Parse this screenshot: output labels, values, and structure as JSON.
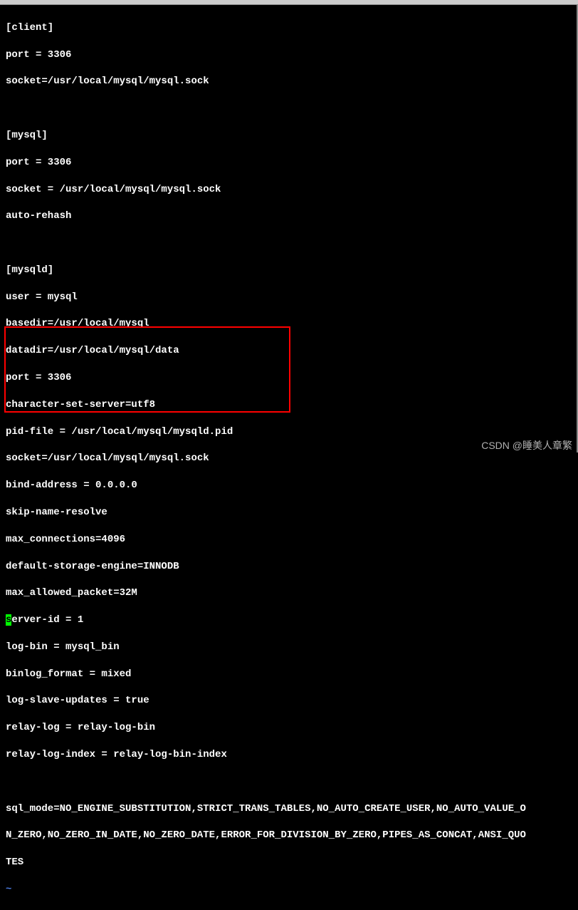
{
  "config": {
    "client": {
      "section": "[client]",
      "port": "port = 3306",
      "socket": "socket=/usr/local/mysql/mysql.sock"
    },
    "mysql": {
      "section": "[mysql]",
      "port": "port = 3306",
      "socket": "socket = /usr/local/mysql/mysql.sock",
      "autorehash": "auto-rehash"
    },
    "mysqld": {
      "section": "[mysqld]",
      "user": "user = mysql",
      "basedir": "basedir=/usr/local/mysql",
      "datadir": "datadir=/usr/local/mysql/data",
      "port": "port = 3306",
      "charset": "character-set-server=utf8",
      "pidfile": "pid-file = /usr/local/mysql/mysqld.pid",
      "socket": "socket=/usr/local/mysql/mysql.sock",
      "bind": "bind-address = 0.0.0.0",
      "skipname": "skip-name-resolve",
      "maxconn": "max_connections=4096",
      "storage": "default-storage-engine=INNODB",
      "maxpacket": "max_allowed_packet=32M",
      "serverid_first": "s",
      "serverid_rest": "erver-id = 1",
      "logbin": "log-bin = mysql_bin",
      "binlogformat": "binlog_format = mixed",
      "logslave": "log-slave-updates = true",
      "relaylog": "relay-log = relay-log-bin",
      "relaylogindex": "relay-log-index = relay-log-bin-index",
      "sqlmode1": "sql_mode=NO_ENGINE_SUBSTITUTION,STRICT_TRANS_TABLES,NO_AUTO_CREATE_USER,NO_AUTO_VALUE_O",
      "sqlmode2": "N_ZERO,NO_ZERO_IN_DATE,NO_ZERO_DATE,ERROR_FOR_DIVISION_BY_ZERO,PIPES_AS_CONCAT,ANSI_QUO",
      "sqlmode3": "TES"
    },
    "tilde": "~"
  },
  "watermark": "CSDN @睡美人章繁"
}
